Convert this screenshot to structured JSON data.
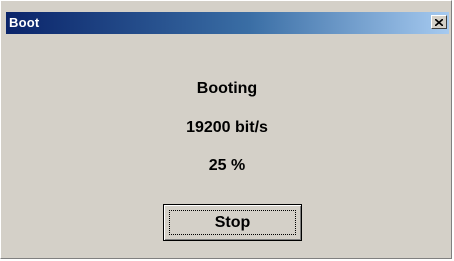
{
  "window": {
    "title": "Boot",
    "close_icon": "close-icon"
  },
  "dialog": {
    "status": "Booting",
    "baud_rate": "19200 bit/s",
    "progress_text": "25 %",
    "progress": 0.25
  },
  "buttons": {
    "stop_label": "Stop"
  },
  "colors": {
    "titlebar_start": "#0a246a",
    "titlebar_end": "#a6caf0",
    "face": "#d4d0c8"
  }
}
